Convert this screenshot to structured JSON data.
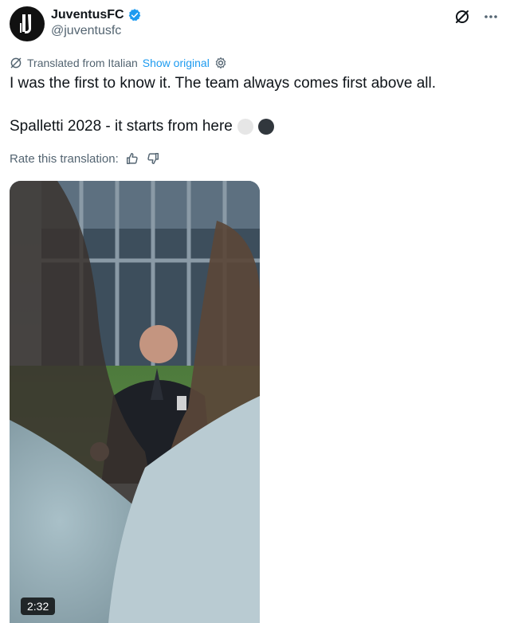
{
  "author": {
    "display_name": "JuventusFC",
    "handle": "@juventusfc",
    "verified": true,
    "avatar_icon": "juventus-logo-icon"
  },
  "header_icons": [
    "grok-icon",
    "more-options-icon"
  ],
  "translation": {
    "label": "Translated from Italian",
    "show_original": "Show original",
    "settings_icon": "gear-icon",
    "translate_icon": "translate-icon"
  },
  "tweet": {
    "line1": "I was the first to know it. The team always comes first above all.",
    "line2": "Spalletti 2028 - it starts from here",
    "emoji_colors": [
      "#e6e6e6",
      "#31373d"
    ]
  },
  "rate": {
    "label": "Rate this translation:",
    "thumbs_up_icon": "thumbs-up-icon",
    "thumbs_down_icon": "thumbs-down-icon"
  },
  "media": {
    "type": "video",
    "duration": "2:32"
  },
  "colors": {
    "text": "#0f1419",
    "secondary": "#536471",
    "accent": "#1d9bf0"
  }
}
